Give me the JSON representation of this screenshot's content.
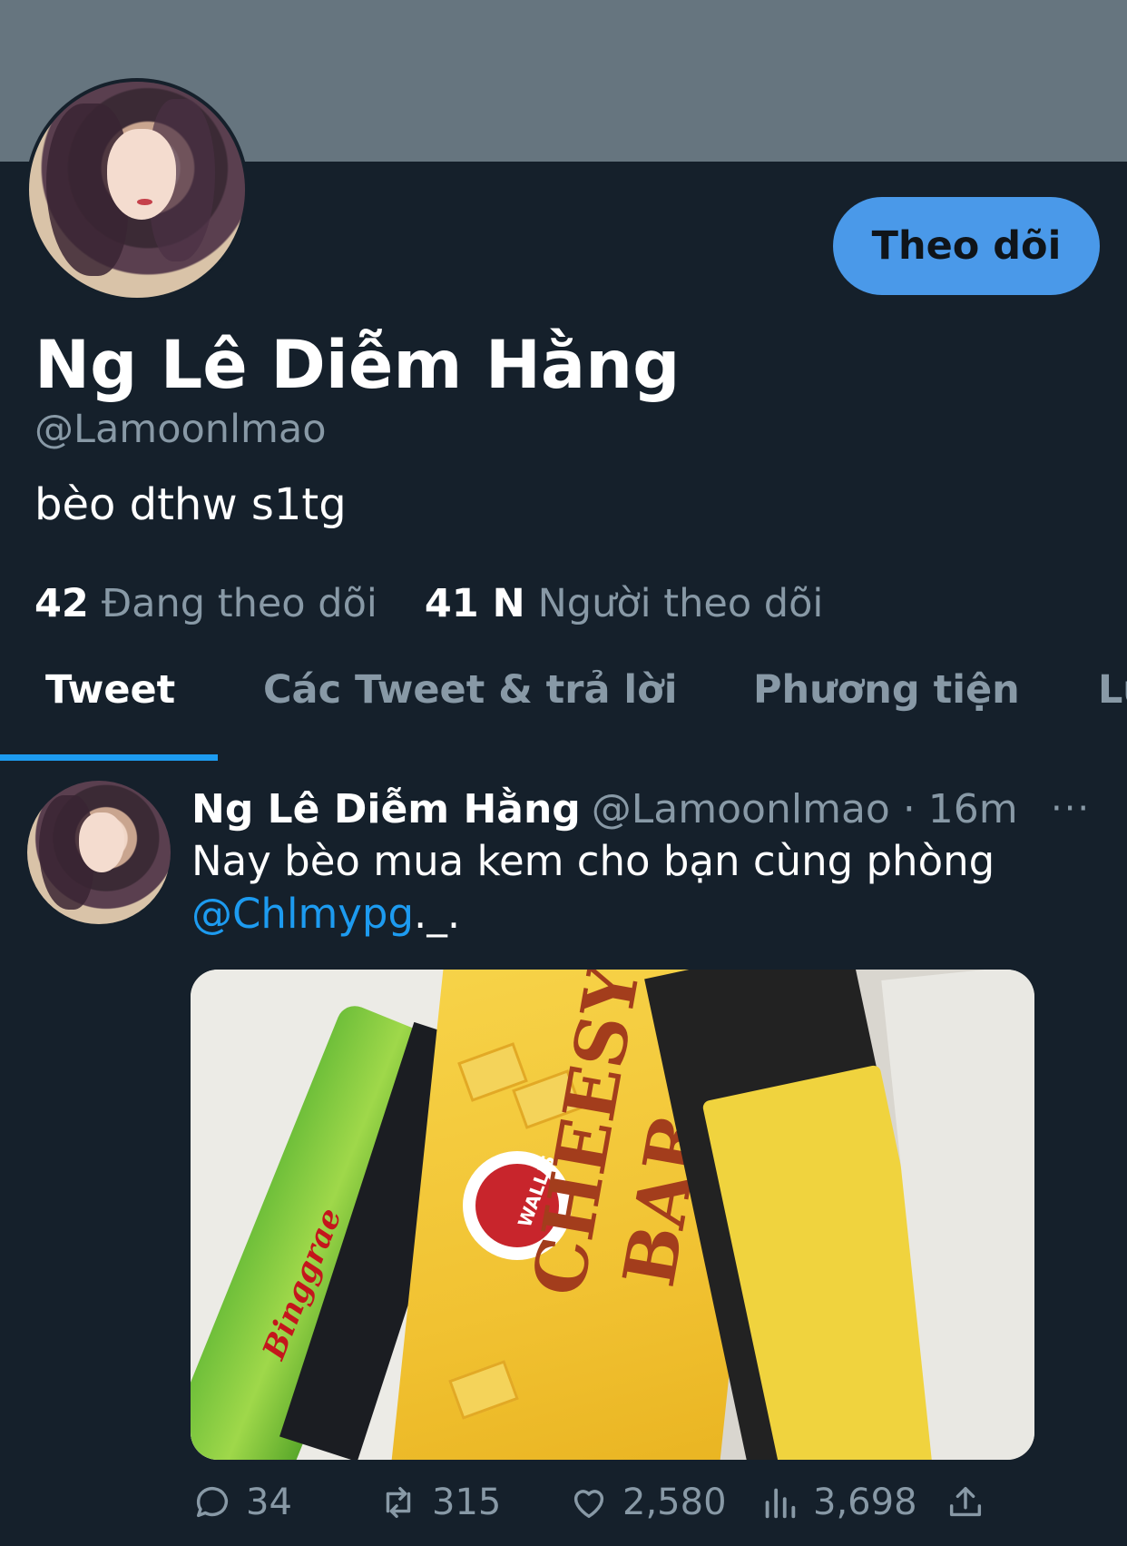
{
  "profile": {
    "display_name": "Ng Lê Diễm Hằng",
    "handle": "@Lamoonlmao",
    "bio": "bèo dthw s1tg",
    "following_count": "42",
    "following_label": "Đang theo dõi",
    "followers_count": "41 N",
    "followers_label": "Người theo dõi",
    "follow_button": "Theo dõi"
  },
  "tabs": [
    {
      "label": "Tweet",
      "active": true
    },
    {
      "label": "Các Tweet & trả lời",
      "active": false
    },
    {
      "label": "Phương tiện",
      "active": false
    },
    {
      "label": "Lư",
      "active": false
    }
  ],
  "tweet": {
    "author_name": "Ng Lê Diễm Hằng",
    "author_meta": "@Lamoonlmao · 16m",
    "text": "Nay bèo mua kem cho bạn cùng phòng",
    "mention": "@Chlmypg",
    "text_suffix": "._.",
    "more_label": "···",
    "media_texts": {
      "brand": "Binggrae",
      "walls": "WALL'S",
      "product_line1": "CHEESY",
      "product_line2": "BAR"
    },
    "replies": "34",
    "retweets": "315",
    "likes": "2,580",
    "views": "3,698"
  },
  "colors": {
    "background": "#15202b",
    "banner": "#66757f",
    "accent": "#1d9bf0",
    "follow_button": "#4a99e9",
    "secondary_text": "#8899a6"
  }
}
